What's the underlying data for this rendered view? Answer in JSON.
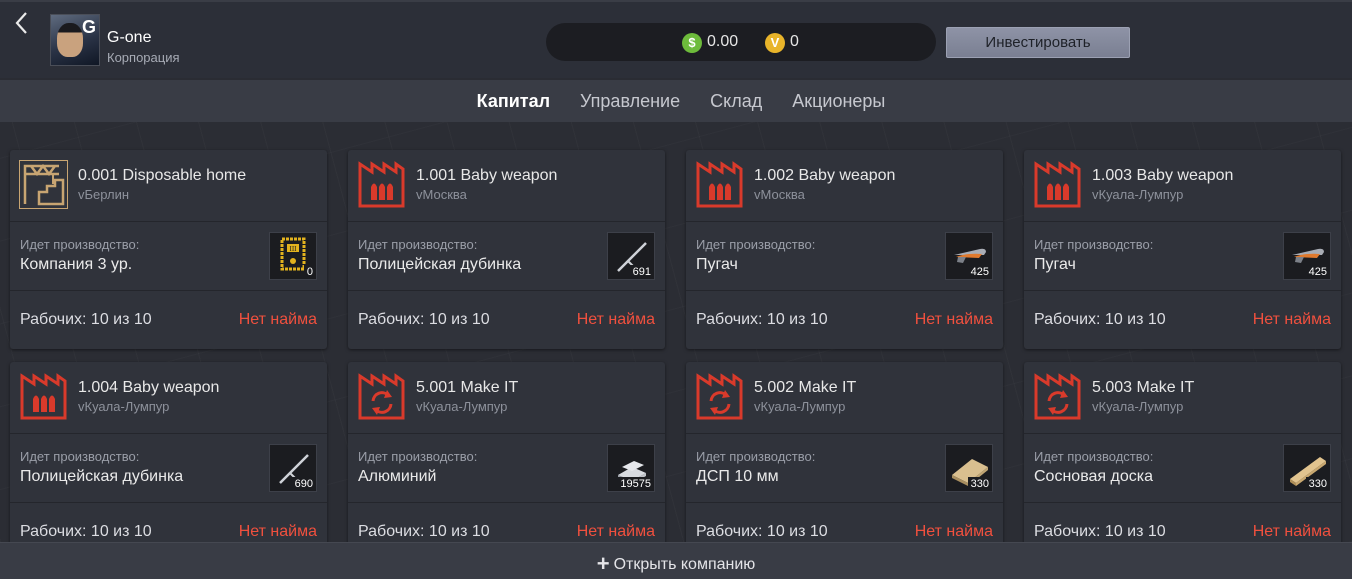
{
  "header": {
    "back_icon": "chevron-left-icon",
    "corp_name": "G-one",
    "corp_type": "Корпорация",
    "avatar_letter": "G",
    "balance_dollar": "0.00",
    "balance_v": "0",
    "coin_dollar_symbol": "$",
    "coin_v_symbol": "V",
    "invest_label": "Инвестировать"
  },
  "tabs": [
    {
      "label": "Капитал",
      "active": true
    },
    {
      "label": "Управление",
      "active": false
    },
    {
      "label": "Склад",
      "active": false
    },
    {
      "label": "Акционеры",
      "active": false
    }
  ],
  "cards": [
    {
      "title": "0.001 Disposable home",
      "city": "vБерлин",
      "icon": "construction-icon",
      "prod_label": "Идет производство:",
      "prod_value": "Компания 3 ур.",
      "item_icon": "certificate-icon",
      "item_count": "0",
      "workers": "Рабочих: 10 из 10",
      "hire": "Нет найма"
    },
    {
      "title": "1.001 Baby weapon",
      "city": "vМосква",
      "icon": "ammo-factory-icon",
      "prod_label": "Идет производство:",
      "prod_value": "Полицейская дубинка",
      "item_icon": "baton-icon",
      "item_count": "691",
      "workers": "Рабочих: 10 из 10",
      "hire": "Нет найма"
    },
    {
      "title": "1.002 Baby weapon",
      "city": "vМосква",
      "icon": "ammo-factory-icon",
      "prod_label": "Идет производство:",
      "prod_value": "Пугач",
      "item_icon": "toy-gun-icon",
      "item_count": "425",
      "workers": "Рабочих: 10 из 10",
      "hire": "Нет найма"
    },
    {
      "title": "1.003 Baby weapon",
      "city": "vКуала-Лумпур",
      "icon": "ammo-factory-icon",
      "prod_label": "Идет производство:",
      "prod_value": "Пугач",
      "item_icon": "toy-gun-icon",
      "item_count": "425",
      "workers": "Рабочих: 10 из 10",
      "hire": "Нет найма"
    },
    {
      "title": "1.004 Baby weapon",
      "city": "vКуала-Лумпур",
      "icon": "ammo-factory-icon",
      "prod_label": "Идет производство:",
      "prod_value": "Полицейская дубинка",
      "item_icon": "baton-icon",
      "item_count": "690",
      "workers": "Рабочих: 10 из 10",
      "hire": "Нет найма"
    },
    {
      "title": "5.001 Make IT",
      "city": "vКуала-Лумпур",
      "icon": "recycle-factory-icon",
      "prod_label": "Идет производство:",
      "prod_value": "Алюминий",
      "item_icon": "aluminum-ingot-icon",
      "item_count": "19575",
      "workers": "Рабочих: 10 из 10",
      "hire": "Нет найма"
    },
    {
      "title": "5.002 Make IT",
      "city": "vКуала-Лумпур",
      "icon": "recycle-factory-icon",
      "prod_label": "Идет производство:",
      "prod_value": "ДСП 10 мм",
      "item_icon": "chipboard-icon",
      "item_count": "330",
      "workers": "Рабочих: 10 из 10",
      "hire": "Нет найма"
    },
    {
      "title": "5.003 Make IT",
      "city": "vКуала-Лумпур",
      "icon": "recycle-factory-icon",
      "prod_label": "Идет производство:",
      "prod_value": "Сосновая доска",
      "item_icon": "pine-board-icon",
      "item_count": "330",
      "workers": "Рабочих: 10 из 10",
      "hire": "Нет найма"
    }
  ],
  "footer": {
    "open_company_label": "Открыть компанию",
    "plus_icon": "plus-icon"
  },
  "colors": {
    "accent_red": "#f0503e",
    "factory_red": "#d93a2b",
    "construction_gold": "#c8a572"
  }
}
